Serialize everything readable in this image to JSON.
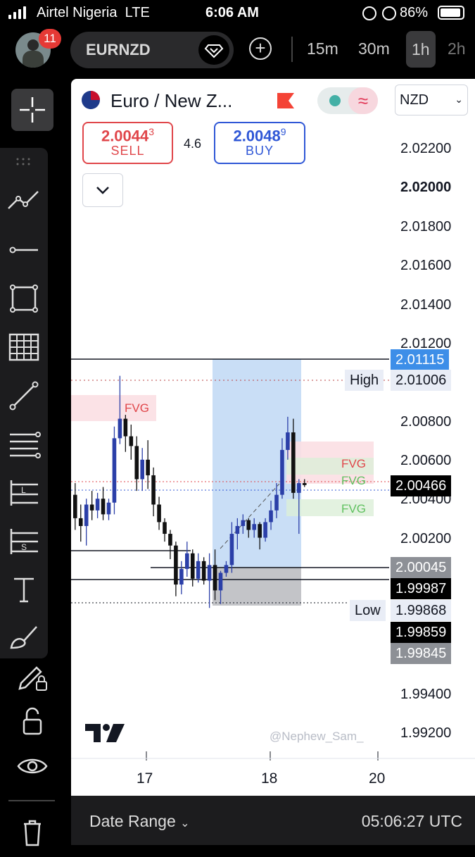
{
  "status_bar": {
    "carrier": "Airtel Nigeria",
    "network": "LTE",
    "time": "6:06 AM",
    "battery": "86%"
  },
  "top_bar": {
    "notification_count": "11",
    "symbol": "EURNZD",
    "timeframes": [
      "15m",
      "30m",
      "1h",
      "2h"
    ],
    "active_timeframe": "1h"
  },
  "chart_header": {
    "pair_title": "Euro / New Z...",
    "currency_select": "NZD",
    "sell_price": "2.0044",
    "sell_sup": "3",
    "sell_label": "SELL",
    "spread": "4.6",
    "buy_price": "2.0048",
    "buy_sup": "9",
    "buy_label": "BUY"
  },
  "y_axis_labels": [
    "2.02200",
    "2.02000",
    "2.01800",
    "2.01600",
    "2.01400",
    "2.01200",
    "2.00800",
    "2.00600",
    "2.00400",
    "2.00200",
    "1.99400",
    "1.99200"
  ],
  "price_tags": {
    "upper_line": "2.01115",
    "high_label": "High",
    "high": "2.01006",
    "current": "2.00466",
    "level_a": "2.00045",
    "level_b": "1.99987",
    "low_label": "Low",
    "low": "1.99868",
    "level_c": "1.99859",
    "level_d": "1.99845"
  },
  "annotations": {
    "fvg": "FVG",
    "watermark": "@Nephew_Sam_"
  },
  "x_axis_labels": [
    "17",
    "18",
    "20"
  ],
  "bottom_bar": {
    "date_range": "Date Range",
    "time_utc": "05:06:27 UTC"
  },
  "colors": {
    "sell": "#e0464a",
    "buy": "#2f57d6",
    "bull_candle": "#2b3fa8",
    "bear_candle": "#111111",
    "position_box": "#9cc3ee",
    "current_tag": "#000000"
  },
  "chart_data": {
    "type": "candlestick",
    "title": "",
    "y_range": [
      1.9915,
      2.023
    ],
    "x_ticks": [
      "17",
      "18",
      "20"
    ],
    "candles": [
      {
        "o": 2.0042,
        "h": 2.0048,
        "l": 2.0024,
        "c": 2.003
      },
      {
        "o": 2.003,
        "h": 2.0037,
        "l": 2.0018,
        "c": 2.0026
      },
      {
        "o": 2.0026,
        "h": 2.004,
        "l": 2.0016,
        "c": 2.0037
      },
      {
        "o": 2.0037,
        "h": 2.0044,
        "l": 2.0029,
        "c": 2.0034
      },
      {
        "o": 2.0034,
        "h": 2.0043,
        "l": 2.003,
        "c": 2.004
      },
      {
        "o": 2.004,
        "h": 2.0046,
        "l": 2.0029,
        "c": 2.0032
      },
      {
        "o": 2.0032,
        "h": 2.004,
        "l": 2.0029,
        "c": 2.0038
      },
      {
        "o": 2.0038,
        "h": 2.0077,
        "l": 2.0032,
        "c": 2.0071
      },
      {
        "o": 2.0071,
        "h": 2.0103,
        "l": 2.0068,
        "c": 2.0081
      },
      {
        "o": 2.0081,
        "h": 2.0083,
        "l": 2.0064,
        "c": 2.0072
      },
      {
        "o": 2.0072,
        "h": 2.0078,
        "l": 2.006,
        "c": 2.0067
      },
      {
        "o": 2.0067,
        "h": 2.0072,
        "l": 2.0044,
        "c": 2.005
      },
      {
        "o": 2.005,
        "h": 2.0066,
        "l": 2.0044,
        "c": 2.006
      },
      {
        "o": 2.006,
        "h": 2.007,
        "l": 2.0045,
        "c": 2.0052
      },
      {
        "o": 2.0052,
        "h": 2.0056,
        "l": 2.0031,
        "c": 2.0037
      },
      {
        "o": 2.0037,
        "h": 2.0041,
        "l": 2.0024,
        "c": 2.0028
      },
      {
        "o": 2.0028,
        "h": 2.003,
        "l": 2.0018,
        "c": 2.0022
      },
      {
        "o": 2.0022,
        "h": 2.0024,
        "l": 2.0009,
        "c": 2.0016
      },
      {
        "o": 2.0016,
        "h": 2.0018,
        "l": 1.999,
        "c": 1.9996
      },
      {
        "o": 1.9996,
        "h": 2.0008,
        "l": 1.9991,
        "c": 2.0004
      },
      {
        "o": 2.0004,
        "h": 2.0018,
        "l": 2.0,
        "c": 2.0012
      },
      {
        "o": 2.0012,
        "h": 2.0014,
        "l": 1.9995,
        "c": 1.9999
      },
      {
        "o": 1.9999,
        "h": 2.0012,
        "l": 1.9997,
        "c": 2.0008
      },
      {
        "o": 2.0008,
        "h": 2.001,
        "l": 1.9996,
        "c": 1.9998
      },
      {
        "o": 1.9998,
        "h": 2.0012,
        "l": 1.9984,
        "c": 2.0006
      },
      {
        "o": 2.0006,
        "h": 2.0014,
        "l": 1.9988,
        "c": 1.9993
      },
      {
        "o": 1.9993,
        "h": 2.0003,
        "l": 1.9986,
        "c": 2.0002
      },
      {
        "o": 2.0002,
        "h": 2.0008,
        "l": 2.0,
        "c": 2.0006
      },
      {
        "o": 2.0006,
        "h": 2.0028,
        "l": 2.0002,
        "c": 2.0022
      },
      {
        "o": 2.0022,
        "h": 2.003,
        "l": 2.0014,
        "c": 2.0026
      },
      {
        "o": 2.0026,
        "h": 2.0032,
        "l": 2.0022,
        "c": 2.0029
      },
      {
        "o": 2.0029,
        "h": 2.003,
        "l": 2.002,
        "c": 2.0024
      },
      {
        "o": 2.0024,
        "h": 2.003,
        "l": 2.002,
        "c": 2.0027
      },
      {
        "o": 2.0027,
        "h": 2.0028,
        "l": 2.0014,
        "c": 2.002
      },
      {
        "o": 2.002,
        "h": 2.003,
        "l": 2.0018,
        "c": 2.0028
      },
      {
        "o": 2.0028,
        "h": 2.0039,
        "l": 2.0024,
        "c": 2.0034
      },
      {
        "o": 2.0034,
        "h": 2.0048,
        "l": 2.003,
        "c": 2.0042
      },
      {
        "o": 2.0042,
        "h": 2.0071,
        "l": 2.004,
        "c": 2.0065
      },
      {
        "o": 2.0065,
        "h": 2.0082,
        "l": 2.006,
        "c": 2.0074
      },
      {
        "o": 2.0074,
        "h": 2.0081,
        "l": 2.004,
        "c": 2.0043
      },
      {
        "o": 2.0043,
        "h": 2.005,
        "l": 2.0022,
        "c": 2.0048
      },
      {
        "o": 2.0048,
        "h": 2.005,
        "l": 2.0046,
        "c": 2.0047
      }
    ]
  }
}
